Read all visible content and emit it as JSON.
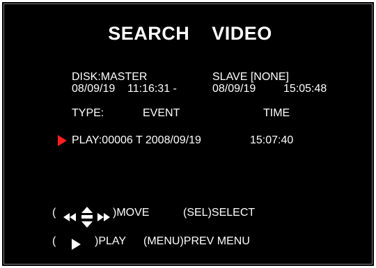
{
  "title": "SEARCH    VIDEO",
  "disk": {
    "master_label": "DISK:MASTER",
    "slave_label": "SLAVE [NONE]",
    "start_date": "08/09/19",
    "start_time": "11:16:31 -",
    "end_date": "08/09/19",
    "end_time": "15:05:48"
  },
  "list_header": {
    "type_label": "TYPE:",
    "type_value": "EVENT",
    "time_label": "TIME"
  },
  "entries": [
    {
      "label": "PLAY:00006 T 2008/09/19",
      "time": "15:07:40",
      "selected": true
    }
  ],
  "help": {
    "move_open": "(",
    "move_label": ")MOVE",
    "select_label": "(SEL)SELECT",
    "play_open": "(",
    "play_label": ")PLAY",
    "prev_menu_label": "(MENU)PREV MENU"
  },
  "colors": {
    "background": "#000000",
    "text": "#ffffff",
    "cursor": "#ff1f1f"
  },
  "icons": {
    "cursor": "selection-arrow-icon",
    "move": "direction-arrows-icon",
    "play": "play-icon"
  }
}
